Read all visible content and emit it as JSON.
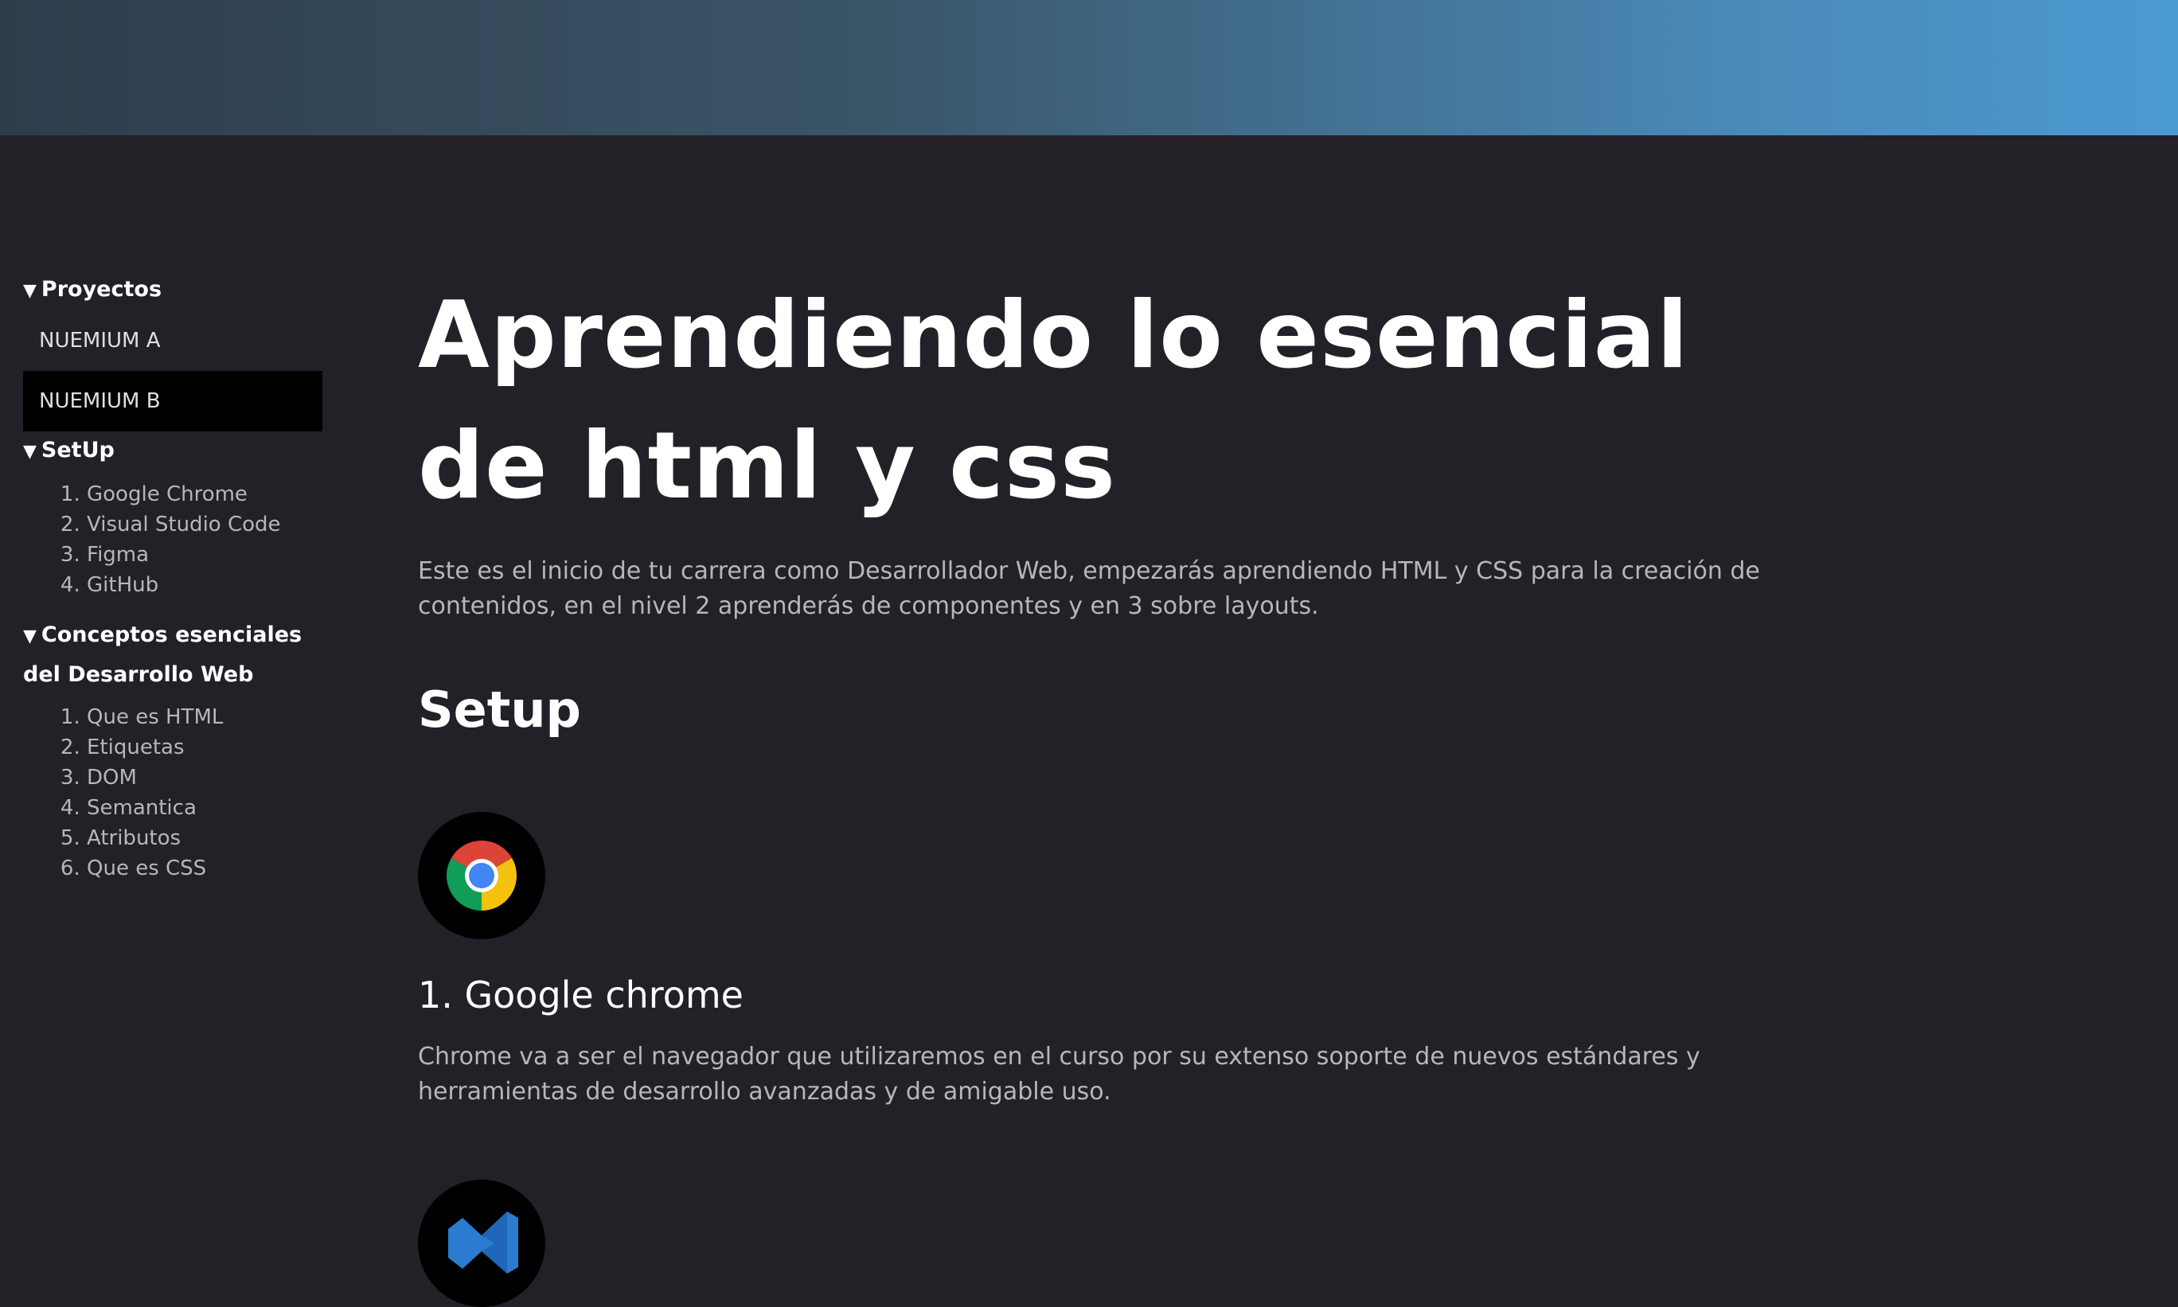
{
  "sidebar": {
    "projects": {
      "title": "Proyectos",
      "items": [
        {
          "label": "NUEMIUM A"
        },
        {
          "label": "NUEMIUM B"
        }
      ]
    },
    "setup": {
      "title": "SetUp",
      "items": [
        "Google Chrome",
        "Visual Studio Code",
        "Figma",
        "GitHub"
      ]
    },
    "concepts": {
      "title": "Conceptos esenciales del Desarrollo Web",
      "items": [
        "Que es HTML",
        "Etiquetas",
        "DOM",
        "Semantica",
        "Atributos",
        "Que es CSS"
      ]
    }
  },
  "main": {
    "title": "Aprendiendo lo esencial de html y css",
    "intro": "Este es el inicio de tu carrera como Desarrollador Web, empezarás aprendiendo HTML y CSS para la creación de contenidos, en el nivel 2 aprenderás de componentes y en 3 sobre layouts.",
    "setup_title": "Setup",
    "tools": [
      {
        "icon": "chrome-icon",
        "title": "1. Google chrome",
        "description": "Chrome va a ser el navegador que utilizaremos en el curso por su extenso soporte de nuevos estándares y herramientas de desarrollo avanzadas y de amigable uso."
      },
      {
        "icon": "vscode-icon"
      }
    ]
  },
  "colors": {
    "background": "#232027",
    "header_gradient_start": "#2e3d4c",
    "header_gradient_end": "#4b9ad2",
    "muted_text": "#b8b5bd",
    "active_item_bg": "#000000"
  }
}
